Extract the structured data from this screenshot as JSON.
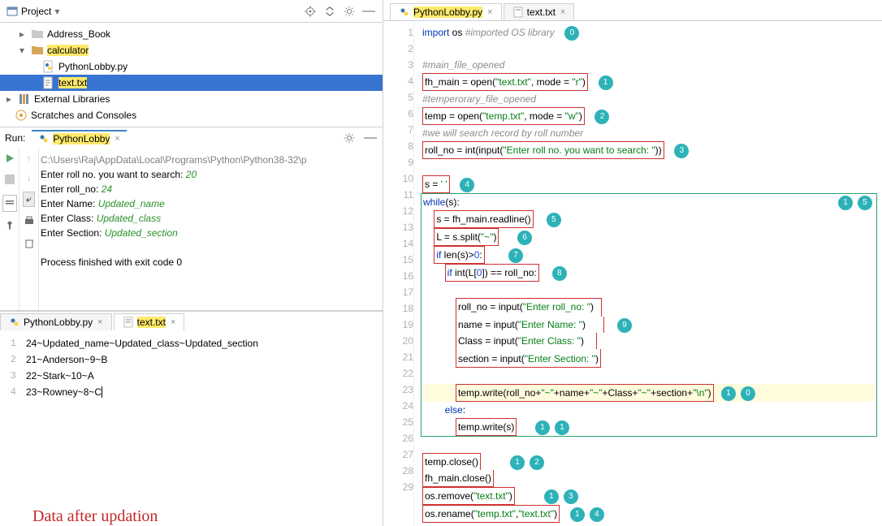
{
  "toolbar": {
    "project_label": "Project"
  },
  "tree": {
    "items": [
      {
        "name": "Address_Book",
        "icon": "folder",
        "indent": 1,
        "arrow": "▸"
      },
      {
        "name": "calculator",
        "icon": "folder-hl",
        "indent": 1,
        "arrow": "▾"
      },
      {
        "name": "PythonLobby.py",
        "icon": "py",
        "indent": 2,
        "arrow": ""
      },
      {
        "name": "text.txt",
        "icon": "txt-hl",
        "indent": 2,
        "arrow": "",
        "sel": true
      },
      {
        "name": "External Libraries",
        "icon": "lib",
        "indent": 0,
        "arrow": "▸"
      },
      {
        "name": "Scratches and Consoles",
        "icon": "scratch",
        "indent": 0,
        "arrow": ""
      }
    ]
  },
  "run": {
    "label": "Run:",
    "tab": "PythonLobby",
    "lines": {
      "path": "C:\\Users\\Raj\\AppData\\Local\\Programs\\Python\\Python38-32\\p",
      "prompt1": "Enter roll no. you want to search: ",
      "val1": "20",
      "prompt2": "Enter roll_no: ",
      "val2": "24",
      "prompt3": "Enter Name: ",
      "val3": "Updated_name",
      "prompt4": "Enter Class: ",
      "val4": "Updated_class",
      "prompt5": "Enter Section: ",
      "val5": "Updated_section",
      "done": "Process finished with exit code 0"
    }
  },
  "bottom_tabs": {
    "a": "PythonLobby.py",
    "b": "text.txt"
  },
  "textfile": {
    "rows": [
      "24~Updated_name~Updated_class~Updated_section",
      "21~Anderson~9~B",
      "22~Stark~10~A",
      "23~Rowney~8~C"
    ]
  },
  "annotation": "Data after updation",
  "editor_tabs": {
    "a": "PythonLobby.py",
    "b": "text.txt"
  },
  "code": {
    "l1a": "import",
    "l1b": " os ",
    "l1c": "#imported OS library",
    "l3": "#main_file_opened",
    "l4a": "fh_main = open(",
    "l4b": "\"text.txt\"",
    "l4c": ", mode = ",
    "l4d": "\"r\"",
    "l4e": ")",
    "l5": "#temperorary_file_opened",
    "l6a": "temp = open(",
    "l6b": "\"temp.txt\"",
    "l6c": ", mode = ",
    "l6d": "\"w\"",
    "l6e": ")",
    "l7": "#we will search record by roll number",
    "l8a": "roll_no = int(input(",
    "l8b": "\"Enter roll no. you want to search: \"",
    "l8c": "))",
    "l10a": "s = ",
    "l10b": "' '",
    "l11a": "while",
    "l11b": "(s):",
    "l12": "s = fh_main.readline()",
    "l13a": "L = s.split(",
    "l13b": "\"~\"",
    "l13c": ")",
    "l14a": "if",
    "l14b": " len(s)>",
    "l14c": "0",
    "l14d": ":",
    "l15a": "if",
    "l15b": " int(L[",
    "l15c": "0",
    "l15d": "]) == roll_no:",
    "l17a": "roll_no = input(",
    "l17b": "\"Enter roll_no: \"",
    "l17c": ")",
    "l18a": "name = input(",
    "l18b": "\"Enter Name: \"",
    "l18c": ")",
    "l19a": "Class = input(",
    "l19b": "\"Enter Class: \"",
    "l19c": ")",
    "l20a": "section = input(",
    "l20b": "\"Enter Section: \"",
    "l20c": ")",
    "l22a": "temp.write(roll_no+",
    "l22b": "\"~\"",
    "l22c": "+name+",
    "l22d": "\"~\"",
    "l22e": "+Class+",
    "l22f": "\"~\"",
    "l22g": "+section+",
    "l22h": "\"\\n\"",
    "l22i": ")",
    "l23a": "else",
    "l23b": ":",
    "l24": "temp.write(s)",
    "l26": "temp.close()",
    "l27": "fh_main.close()",
    "l28a": "os.remove(",
    "l28b": "\"text.txt\"",
    "l28c": ")",
    "l29a": "os.rename(",
    "l29b": "\"temp.txt\"",
    "l29c": ",",
    "l29d": "\"text.txt\"",
    "l29e": ")"
  },
  "badges": {
    "b0": "0",
    "b1": "1",
    "b2": "2",
    "b3": "3",
    "b4": "4",
    "b5": "5",
    "b6": "6",
    "b7": "7",
    "b8": "8",
    "b9": "9",
    "b10": "10",
    "b11": "11",
    "b12": "12",
    "b13": "13",
    "b14": "14",
    "b15": "15"
  },
  "gutter": [
    "1",
    "2",
    "3",
    "4",
    "5",
    "6",
    "7",
    "8",
    "9",
    "10",
    "11",
    "12",
    "13",
    "14",
    "15",
    "16",
    "17",
    "18",
    "19",
    "20",
    "21",
    "22",
    "23",
    "24",
    "25",
    "26",
    "27",
    "28",
    "29"
  ]
}
